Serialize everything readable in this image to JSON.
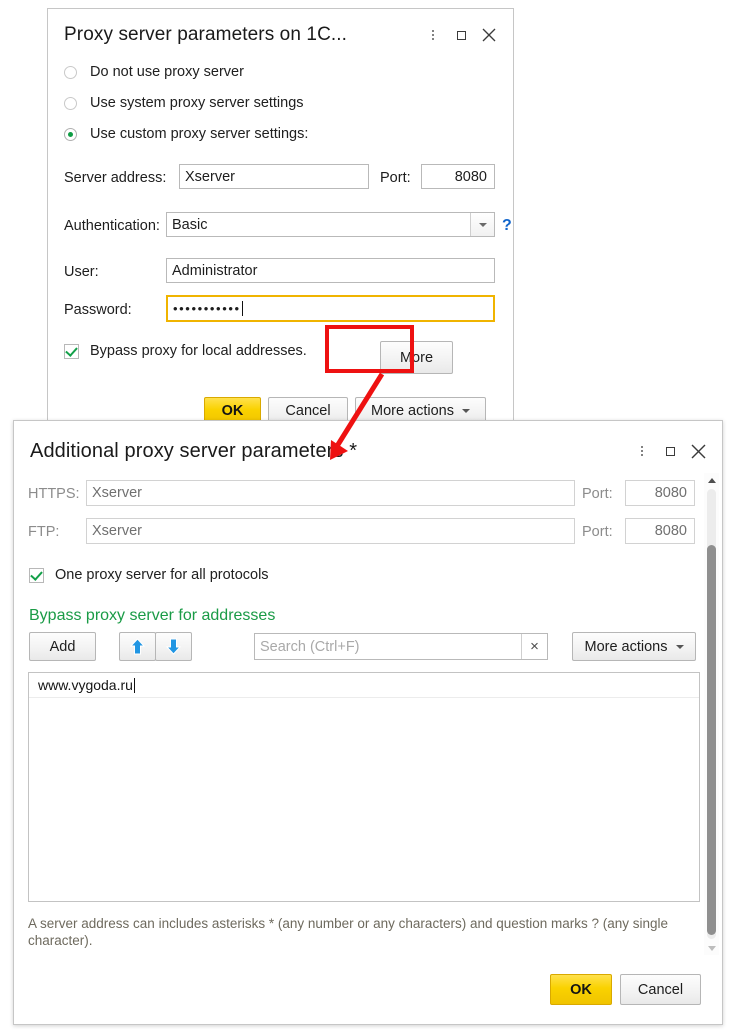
{
  "dialog1": {
    "title": "Proxy server parameters on 1C...",
    "title_buttons": [
      "menu-kebab",
      "maximize",
      "close"
    ],
    "radios": [
      {
        "label": "Do not use proxy server",
        "checked": false
      },
      {
        "label": "Use system proxy server settings",
        "checked": false
      },
      {
        "label": "Use custom proxy server settings:",
        "checked": true
      }
    ],
    "server_address_label": "Server address:",
    "server_address_value": "Xserver",
    "port_label": "Port:",
    "port_value": "8080",
    "auth_label": "Authentication:",
    "auth_value": "Basic",
    "help_glyph": "?",
    "user_label": "User:",
    "user_value": "Administrator",
    "password_label": "Password:",
    "password_value": "•••••••••••",
    "bypass_label": "Bypass proxy for local addresses.",
    "bypass_checked": true,
    "more_button": "More",
    "ok_button": "OK",
    "cancel_button": "Cancel",
    "more_actions_button": "More actions"
  },
  "dialog2": {
    "title": "Additional proxy server parameters *",
    "title_buttons": [
      "menu-kebab",
      "maximize",
      "close"
    ],
    "https_label": "HTTPS:",
    "https_value": "Xserver",
    "https_port_label": "Port:",
    "https_port_value": "8080",
    "ftp_label": "FTP:",
    "ftp_value": "Xserver",
    "ftp_port_label": "Port:",
    "ftp_port_value": "8080",
    "one_proxy_label": "One proxy server for all protocols",
    "one_proxy_checked": true,
    "section_title": "Bypass proxy server for addresses",
    "add_button": "Add",
    "move_up_icon": "arrow-up",
    "move_down_icon": "arrow-down",
    "search_placeholder": "Search (Ctrl+F)",
    "search_value": "",
    "search_clear": "×",
    "more_actions_button": "More actions",
    "list_rows": [
      "www.vygoda.ru"
    ],
    "hint_text": "A server address can includes asterisks * (any number or any characters) and question marks ? (any single character).",
    "ok_button": "OK",
    "cancel_button": "Cancel"
  },
  "annotation": {
    "color": "#ee1111",
    "highlight_target": "More",
    "points_to": "Additional proxy server parameters *"
  }
}
